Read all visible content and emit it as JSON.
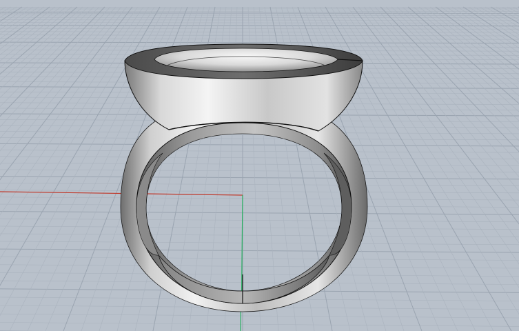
{
  "viewport": {
    "projection": "perspective",
    "colors": {
      "background": "#b9c1cb",
      "grid_minor": "#aab3be",
      "grid_major": "#9aa4b0",
      "axis_x": "#c0392b",
      "axis_y": "#27ae60",
      "model_edge": "#111111"
    },
    "grid": {
      "visible": true
    },
    "axes": {
      "x_axis_visible": true,
      "y_axis_visible": true
    }
  },
  "model": {
    "name": "signet-ring",
    "render_mode": "shaded",
    "material": "silver-grey"
  }
}
